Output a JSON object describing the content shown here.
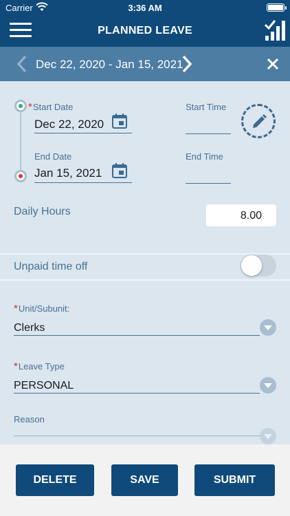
{
  "status_bar": {
    "carrier": "Carrier",
    "time": "3:36 AM"
  },
  "nav": {
    "title": "PLANNED LEAVE",
    "menu_icon": "hamburger-icon",
    "action_icon": "report-chart-icon"
  },
  "date_range": {
    "label": "Dec 22, 2020 - Jan 15, 2021"
  },
  "start_date": {
    "label": "Start Date",
    "value": "Dec 22, 2020",
    "required_mark": "*"
  },
  "end_date": {
    "label": "End Date",
    "value": "Jan 15, 2021"
  },
  "start_time": {
    "label": "Start Time",
    "value": ""
  },
  "end_time": {
    "label": "End Time",
    "value": ""
  },
  "daily_hours": {
    "label": "Daily Hours",
    "value": "8.00"
  },
  "unpaid": {
    "label": "Unpaid time off",
    "on": false
  },
  "unit": {
    "label": "Unit/Subunit:",
    "value": "Clerks",
    "required_mark": "*"
  },
  "leave_type": {
    "label": "Leave Type",
    "value": "PERSONAL",
    "required_mark": "*"
  },
  "reason": {
    "label": "Reason",
    "value": ""
  },
  "buttons": {
    "delete": "DELETE",
    "save": "SAVE",
    "submit": "SUBMIT"
  },
  "colors": {
    "primary": "#0f4a7a",
    "strip": "#4d7da3",
    "background": "#dbe6ef",
    "label": "#4a7093",
    "required": "#d42a2a"
  }
}
